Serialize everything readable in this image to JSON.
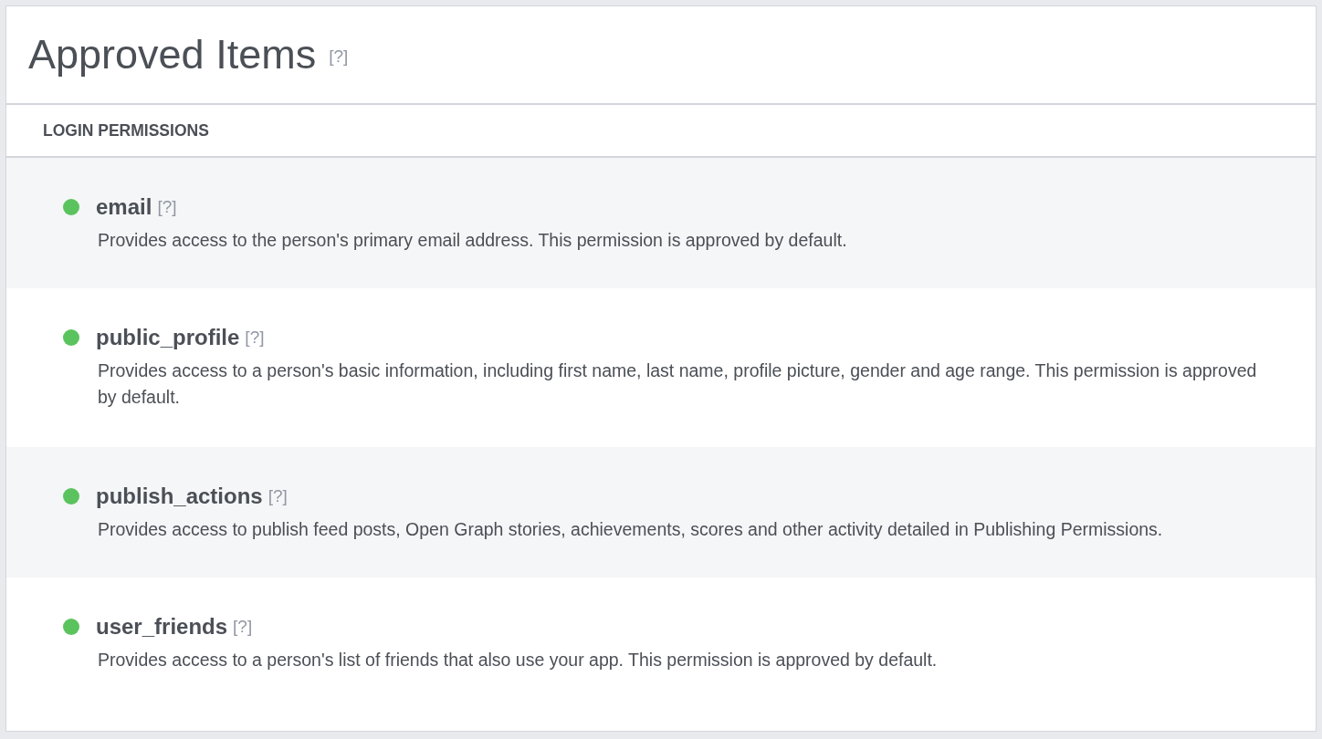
{
  "panel": {
    "title": "Approved Items",
    "help": "[?]"
  },
  "section": {
    "heading": "LOGIN PERMISSIONS"
  },
  "permissions": [
    {
      "name": "email",
      "help": "[?]",
      "description": "Provides access to the person's primary email address. This permission is approved by default."
    },
    {
      "name": "public_profile",
      "help": "[?]",
      "description": "Provides access to a person's basic information, including first name, last name, profile picture, gender and age range. This permission is approved by default."
    },
    {
      "name": "publish_actions",
      "help": "[?]",
      "description": "Provides access to publish feed posts, Open Graph stories, achievements, scores and other activity detailed in Publishing Permissions."
    },
    {
      "name": "user_friends",
      "help": "[?]",
      "description": "Provides access to a person's list of friends that also use your app. This permission is approved by default."
    }
  ]
}
